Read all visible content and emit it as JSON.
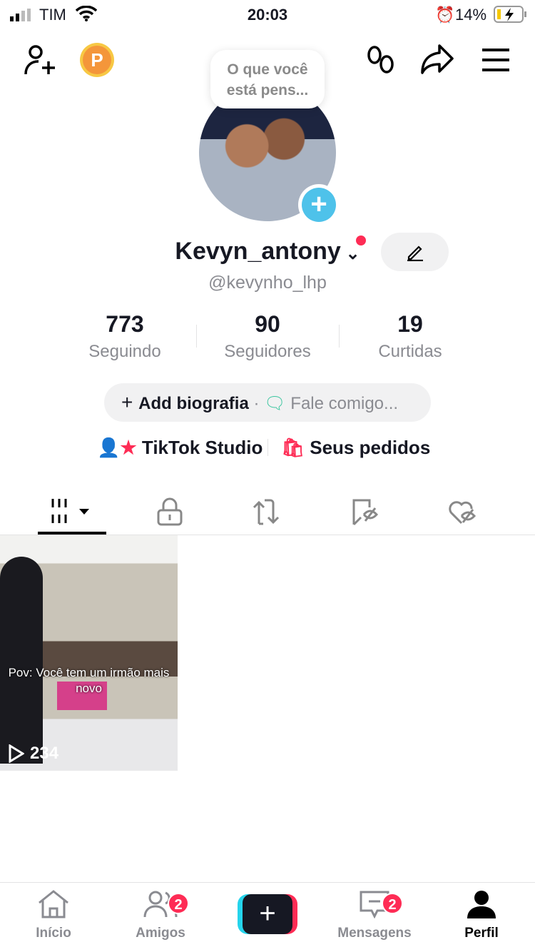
{
  "status_bar": {
    "carrier": "TIM",
    "time": "20:03",
    "battery": "14%"
  },
  "header": {
    "thought_bubble": "O que você está pens..."
  },
  "profile": {
    "display_name": "Kevyn_antony",
    "handle": "@kevynho_lhp",
    "stats": [
      {
        "value": "773",
        "label": "Seguindo"
      },
      {
        "value": "90",
        "label": "Seguidores"
      },
      {
        "value": "19",
        "label": "Curtidas"
      }
    ],
    "bio_button": "Add biografia",
    "bio_separator": "·",
    "bio_prompt": "Fale comigo...",
    "studio_link": "TikTok Studio",
    "orders_link": "Seus pedidos"
  },
  "tabs": [
    "videos-icon",
    "lock-icon",
    "repost-icon",
    "saved-hidden-icon",
    "liked-hidden-icon"
  ],
  "videos": [
    {
      "caption": "Pov: Você tem um irmão mais novo",
      "views": "234"
    }
  ],
  "bottom_nav": [
    {
      "label": "Início"
    },
    {
      "label": "Amigos",
      "badge": "2"
    },
    {
      "label": "+"
    },
    {
      "label": "Mensagens",
      "badge": "2"
    },
    {
      "label": "Perfil"
    }
  ],
  "colors": {
    "accent": "#fe2c55",
    "cyan": "#25d4ec",
    "coin": "#f4a43a"
  }
}
